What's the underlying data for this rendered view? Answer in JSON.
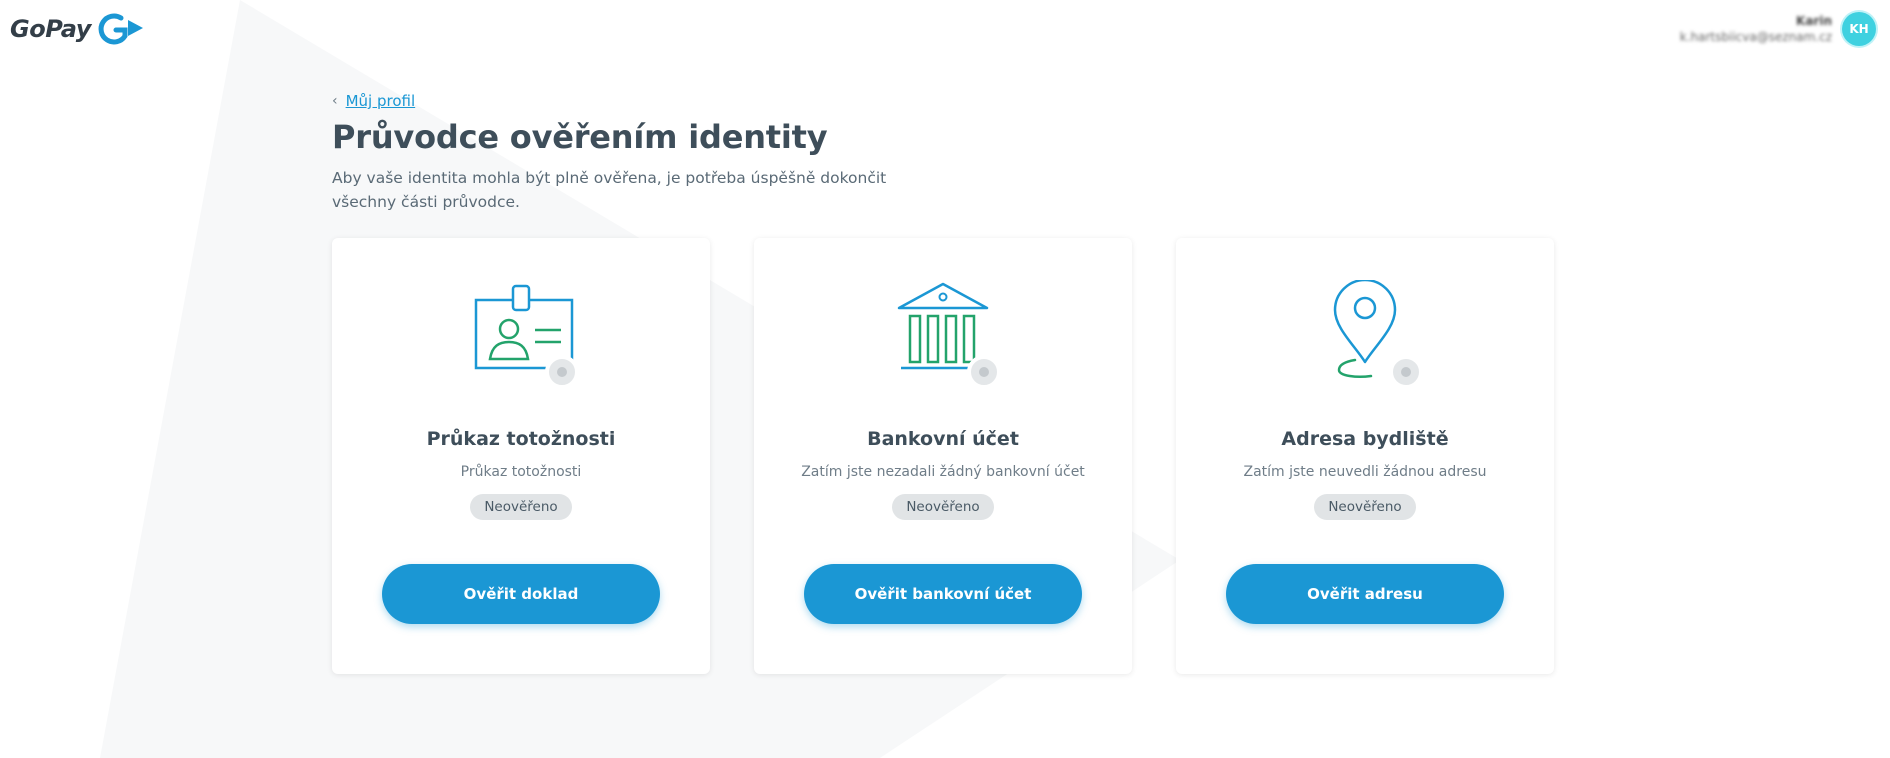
{
  "brand": {
    "name": "GoPay",
    "primary_color": "#1b97d4",
    "accent_color": "#23a36b"
  },
  "user": {
    "name": "Karin",
    "email": "k.hartsbiicva@seznam.cz",
    "initials": "KH"
  },
  "breadcrumb": {
    "chevron": "‹",
    "label": "Můj profil"
  },
  "page": {
    "title": "Průvodce ověřením identity",
    "subtitle": "Aby vaše identita mohla být plně ověřena, je potřeba úspěšně dokončit všechny části průvodce."
  },
  "cards": [
    {
      "icon": "id-card-icon",
      "title": "Průkaz totožnosti",
      "description": "Průkaz totožnosti",
      "status": "Neověřeno",
      "button": "Ověřit doklad"
    },
    {
      "icon": "bank-icon",
      "title": "Bankovní účet",
      "description": "Zatím jste nezadali žádný bankovní účet",
      "status": "Neověřeno",
      "button": "Ověřit bankovní účet"
    },
    {
      "icon": "location-pin-icon",
      "title": "Adresa bydliště",
      "description": "Zatím jste neuvedli žádnou adresu",
      "status": "Neověřeno",
      "button": "Ověřit adresu"
    }
  ]
}
